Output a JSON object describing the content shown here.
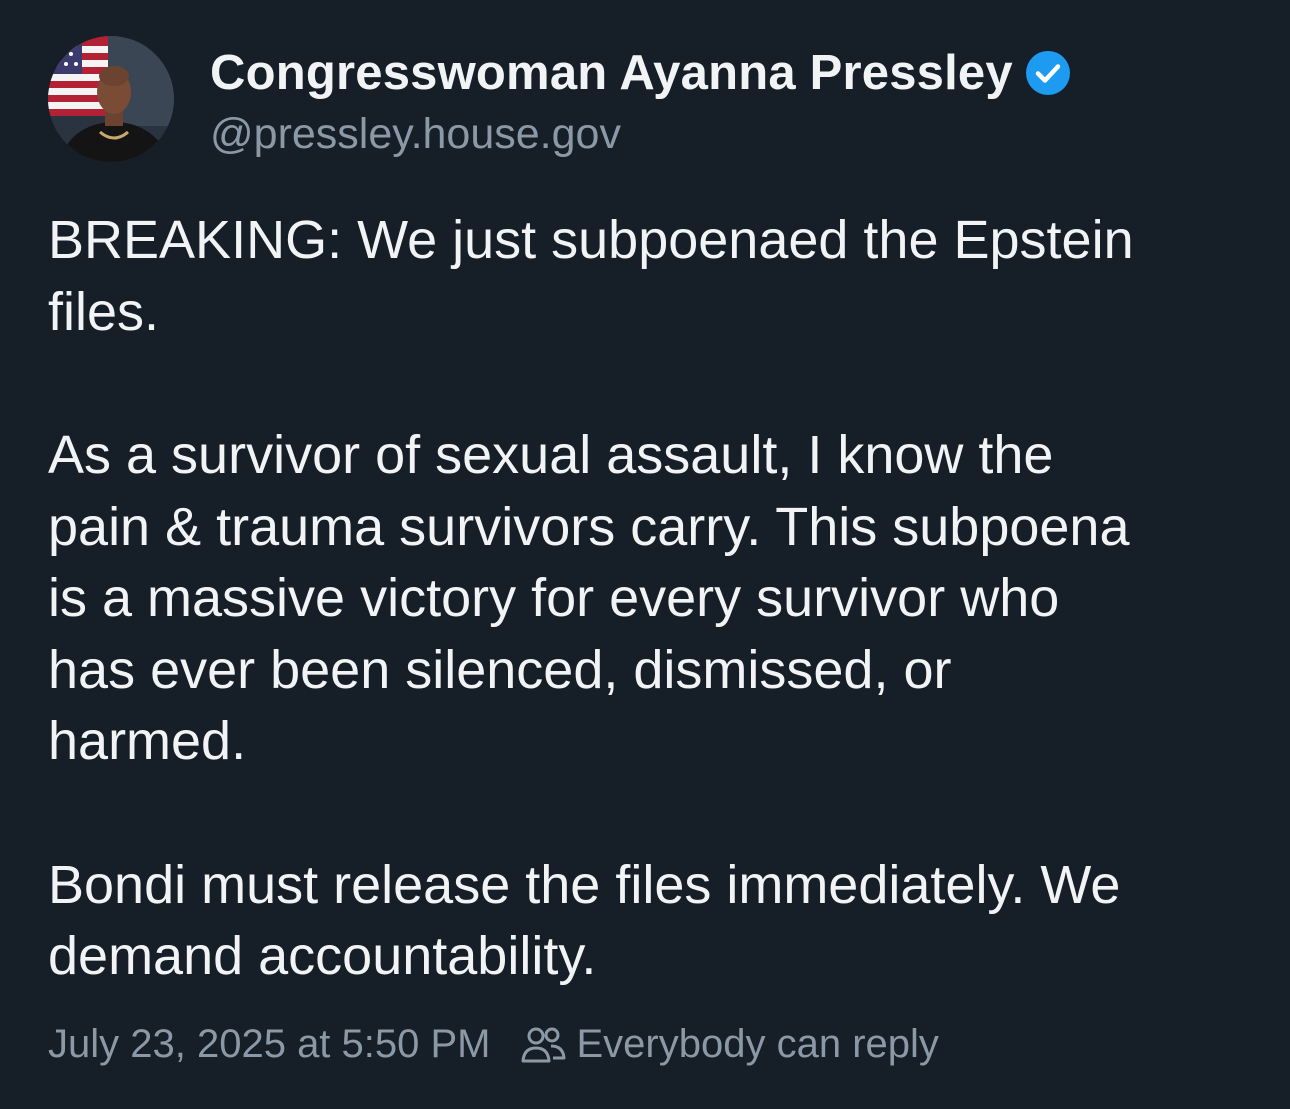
{
  "author": {
    "display_name": "Congresswoman Ayanna Pressley",
    "handle": "@pressley.house.gov",
    "verified": true,
    "verified_color": "#1d9bf0",
    "avatar_icon": "profile-photo"
  },
  "post": {
    "paragraphs": [
      "BREAKING: We just subpoenaed the Epstein\nfiles.",
      "As a survivor of sexual assault, I know the\npain & trauma survivors carry. This subpoena\nis a massive victory for every survivor who\nhas ever been silenced, dismissed, or\nharmed.",
      "Bondi must release the files immediately. We\ndemand accountability."
    ]
  },
  "footer": {
    "timestamp": "July 23, 2025 at 5:50 PM",
    "reply_setting": "Everybody can reply",
    "reply_icon": "people-icon"
  },
  "colors": {
    "background": "#161e27",
    "text": "#f1f3f5",
    "secondary_text": "#8b98a5"
  }
}
